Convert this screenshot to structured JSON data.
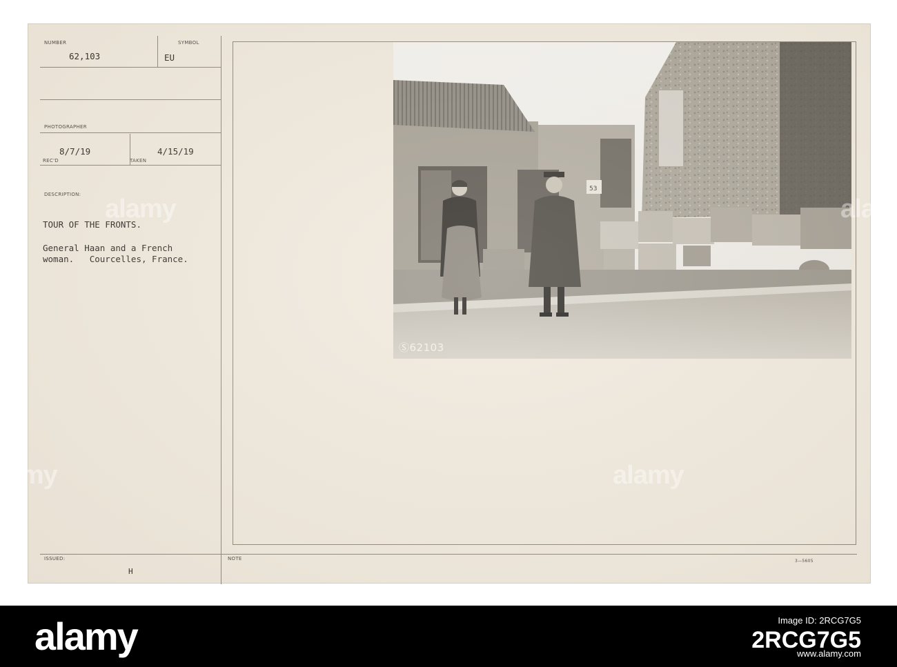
{
  "card": {
    "number_label": "NUMBER",
    "number_value": "62,103",
    "symbol_label": "SYMBOL",
    "symbol_value": "EU",
    "photographer_label": "PHOTOGRAPHER",
    "recd_value": "8/7/19",
    "recd_label": "REC'D",
    "taken_label": "TAKEN",
    "taken_value": "4/15/19",
    "description_label": "DESCRIPTION:",
    "description_lines": [
      "TOUR OF THE FRONTS.",
      "General Haan and a French",
      "woman.   Courcelles, France."
    ],
    "issued_label": "ISSUED:",
    "issued_value": "H",
    "note_label": "NOTE",
    "form_number": "3—5605"
  },
  "photo": {
    "negative_number": "Ⓢ62103",
    "house_number": "53"
  },
  "watermarks": [
    "alamy",
    "alamy",
    "alamy",
    "alamy"
  ],
  "footer": {
    "logo": "alamy",
    "image_id_label": "Image ID: 2RCG7G5",
    "image_id_code": "2RCG7G5",
    "url": "www.alamy.com"
  }
}
